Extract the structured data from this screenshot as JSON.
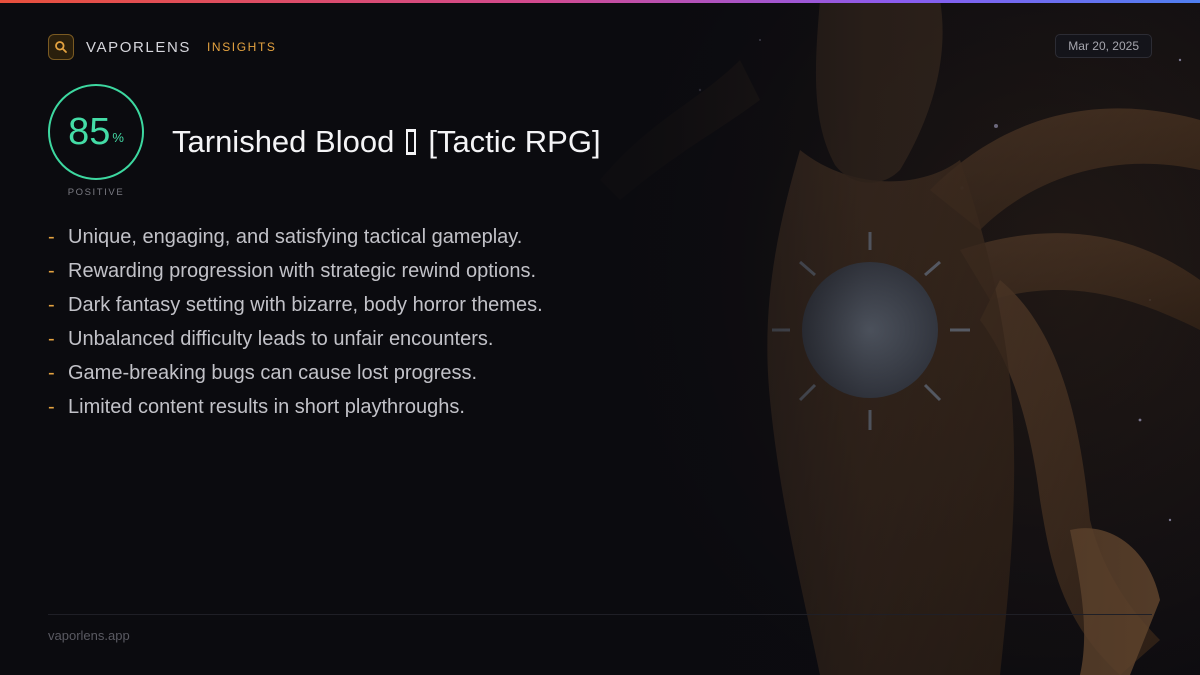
{
  "brand": {
    "name": "VAPORLENS",
    "tag": "INSIGHTS",
    "icon": "search-icon",
    "accent_color": "#e5a340"
  },
  "date": "Mar 20, 2025",
  "score": {
    "value": "85",
    "unit": "%",
    "label": "POSITIVE",
    "color": "#3dd8a0"
  },
  "game": {
    "title_part1": "Tarnished Blood",
    "title_part2": "[Tactic RPG]"
  },
  "bullets": [
    "Unique, engaging, and satisfying tactical gameplay.",
    "Rewarding progression with strategic rewind options.",
    "Dark fantasy setting with bizarre, body horror themes.",
    "Unbalanced difficulty leads to unfair encounters.",
    "Game-breaking bugs can cause lost progress.",
    "Limited content results in short playthroughs."
  ],
  "bullet_marker": "-",
  "footer": {
    "url": "vaporlens.app"
  }
}
